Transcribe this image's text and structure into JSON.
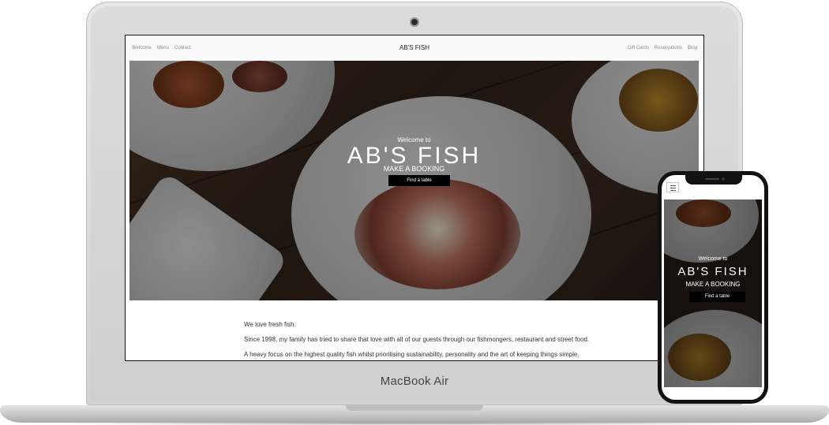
{
  "device": {
    "laptop_brand": "MacBook Air"
  },
  "site": {
    "title": "AB'S FISH",
    "nav_left": [
      "Welcome",
      "Menu",
      "Contact"
    ],
    "nav_right": [
      "Gift Cards",
      "Reservations",
      "Blog"
    ]
  },
  "hero": {
    "welcome": "Welcome to",
    "title": "AB'S FISH",
    "subtitle": "MAKE A BOOKING",
    "button": "Find a table"
  },
  "content": {
    "paragraphs": [
      "We love fresh fish.",
      "Since 1998, my family has tried to share that love with all of our guests through our fishmongers, restaurant and street food.",
      "A heavy focus on the highest quality fish whilst prioritising sustainability, personality and the art of keeping things simple."
    ]
  },
  "mobile": {
    "welcome": "Welcome to",
    "title": "AB'S FISH",
    "subtitle": "MAKE A BOOKING",
    "button": "Find a table"
  },
  "icons": {
    "menu": "hamburger-menu-icon",
    "camera": "camera-icon"
  }
}
